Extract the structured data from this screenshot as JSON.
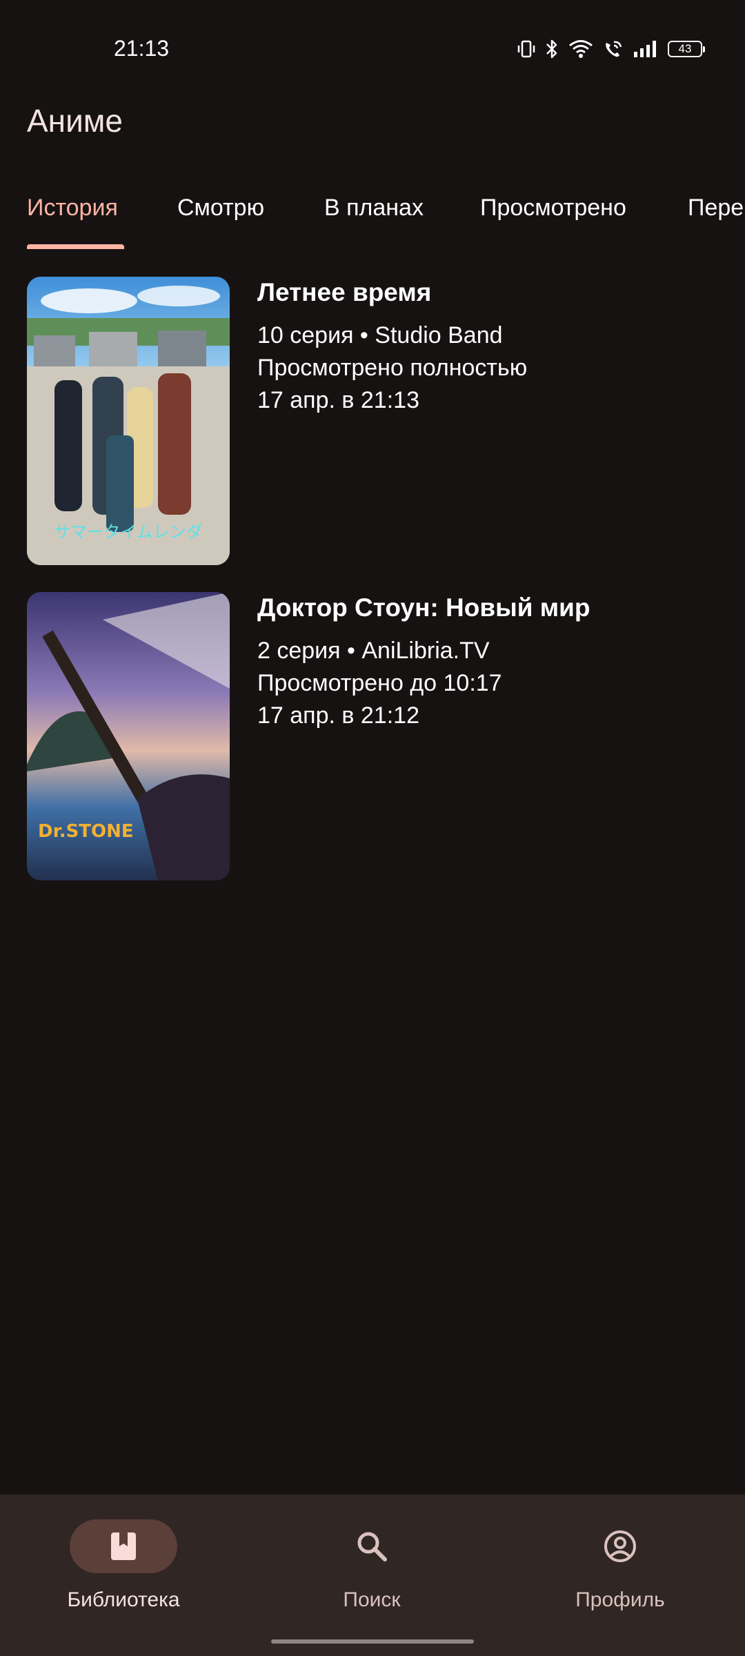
{
  "status_bar": {
    "time": "21:13",
    "battery": "43",
    "icons": [
      "vibrate-icon",
      "bluetooth-icon",
      "wifi-icon",
      "wifi-calling-icon",
      "signal-icon",
      "battery-icon"
    ]
  },
  "header": {
    "title": "Аниме"
  },
  "tabs": [
    {
      "label": "История",
      "active": true
    },
    {
      "label": "Смотрю",
      "active": false
    },
    {
      "label": "В планах",
      "active": false
    },
    {
      "label": "Просмотрено",
      "active": false
    },
    {
      "label": "Пере",
      "active": false
    }
  ],
  "history": [
    {
      "title": "Летнее время",
      "episode_line": "10 серия • Studio Band",
      "progress_line": "Просмотрено полностью",
      "date_line": "17 апр. в 21:13",
      "poster_text": "サマータイムレンダ"
    },
    {
      "title": "Доктор Стоун: Новый мир",
      "episode_line": "2 серия • AniLibria.TV",
      "progress_line": "Просмотрено до 10:17",
      "date_line": "17 апр. в 21:12",
      "poster_text": "Dr.STONE"
    }
  ],
  "bottom_nav": [
    {
      "label": "Библиотека",
      "icon": "bookmark-icon",
      "active": true
    },
    {
      "label": "Поиск",
      "icon": "search-icon",
      "active": false
    },
    {
      "label": "Профиль",
      "icon": "account-icon",
      "active": false
    }
  ],
  "colors": {
    "background": "#161212",
    "accent": "#ffb4a4",
    "nav_background": "#302624",
    "nav_active_pill": "#5b3f39"
  }
}
